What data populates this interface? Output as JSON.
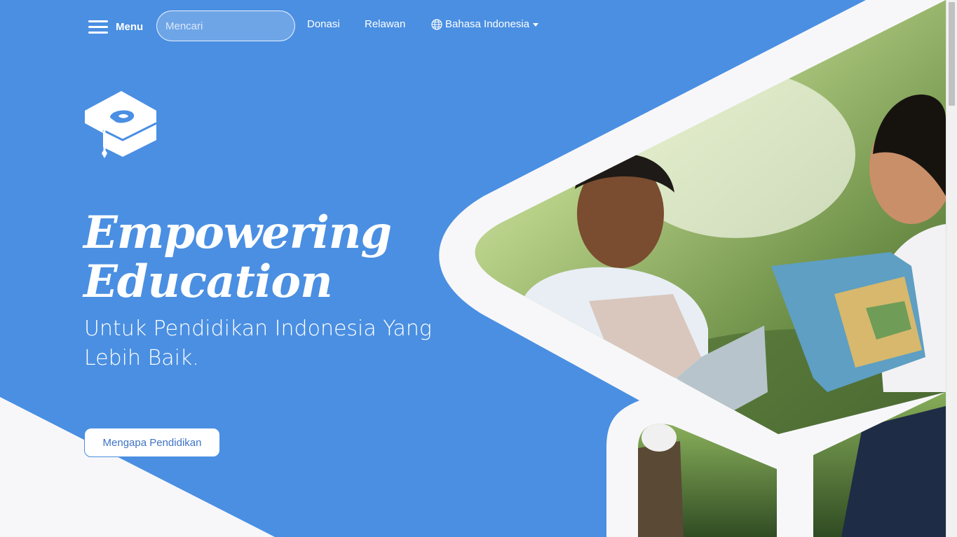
{
  "nav": {
    "menu_label": "Menu",
    "search_placeholder": "Mencari",
    "links": {
      "donate": "Donasi",
      "volunteer": "Relawan"
    },
    "language": "Bahasa Indonesia"
  },
  "hero": {
    "headline_line1": "Empowering",
    "headline_line2": "Education",
    "subtitle_line1": "Untuk Pendidikan Indonesia Yang",
    "subtitle_line2": "Lebih Baik.",
    "cta_label": "Mengapa Pendidikan"
  },
  "colors": {
    "primary_blue": "#4a8fe2",
    "shape_white": "#f7f7f9",
    "cta_text": "#3f74c4"
  },
  "icons": [
    "menu-icon",
    "globe-icon",
    "caret-down-icon",
    "graduation-cap-logo"
  ]
}
